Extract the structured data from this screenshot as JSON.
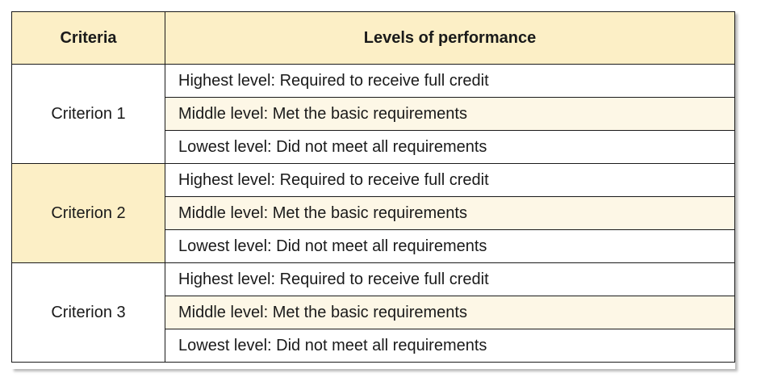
{
  "colors": {
    "header_bg": "#fcefc6",
    "highlight_bg": "#fdf7e6",
    "white": "#ffffff",
    "border": "#1a1a1a"
  },
  "header": {
    "criteria": "Criteria",
    "levels": "Levels of performance"
  },
  "rows": [
    {
      "criterion": "Criterion 1",
      "levels": [
        "Highest level: Required to receive full credit",
        "Middle level: Met the basic requirements",
        "Lowest level: Did not meet all requirements"
      ]
    },
    {
      "criterion": "Criterion 2",
      "levels": [
        "Highest level: Required to receive full credit",
        "Middle level: Met the basic requirements",
        "Lowest level: Did not meet all requirements"
      ]
    },
    {
      "criterion": "Criterion 3",
      "levels": [
        "Highest level: Required to receive full credit",
        "Middle level: Met the basic requirements",
        "Lowest level: Did not meet all requirements"
      ]
    }
  ]
}
